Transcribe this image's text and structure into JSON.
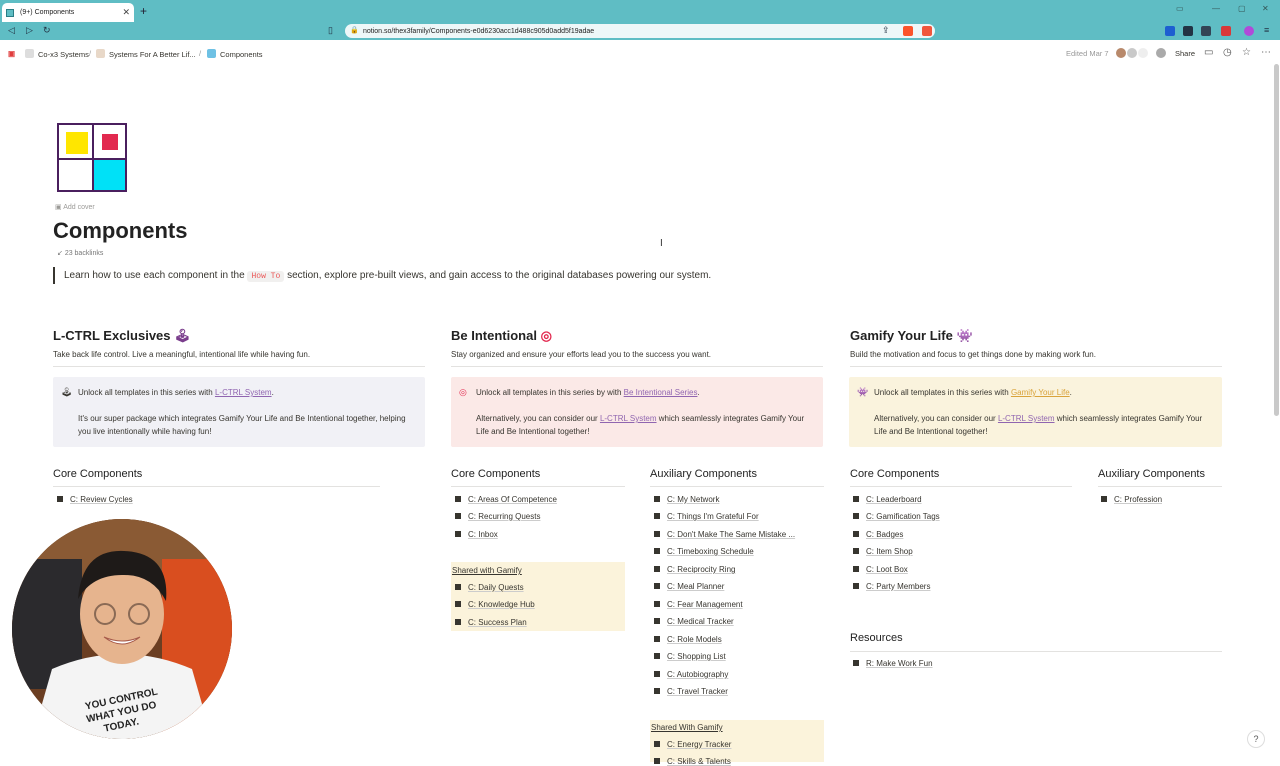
{
  "browser": {
    "tab_title": "(9+) Components",
    "url": "notion.so/thex3family/Components-e0d6230acc1d488c905d0add5f19adae"
  },
  "breadcrumbs": [
    "Co-x3 Systems",
    "Systems For A Better Lif...",
    "Components"
  ],
  "topbar": {
    "edited": "Edited Mar 7",
    "share": "Share"
  },
  "page": {
    "add_cover": "Add cover",
    "title": "Components",
    "backlinks": "23 backlinks",
    "intro_before": "Learn how to use each component in the",
    "intro_code": "How To",
    "intro_after": "section, explore pre-built views, and gain access to the original databases powering our system."
  },
  "columns": {
    "lctrl": {
      "title": "L-CTRL Exclusives",
      "subtitle": "Take back life control. Live a meaningful, intentional life while having fun.",
      "callout_pre": "Unlock all templates in this series with",
      "callout_link": "L-CTRL System",
      "callout_dot": ".",
      "callout_body": "It's our super package which integrates Gamify Your Life and Be Intentional together, helping you live intentionally while having fun!",
      "core_heading": "Core Components",
      "core_items": [
        "C: Review Cycles"
      ]
    },
    "intentional": {
      "title": "Be Intentional",
      "subtitle": "Stay organized and ensure your efforts lead you to the success you want.",
      "callout_pre": "Unlock all templates in this series by with",
      "callout_link": "Be Intentional Series",
      "callout_dot": ".",
      "callout_body_pre": "Alternatively, you can consider our",
      "callout_body_link": "L-CTRL System",
      "callout_body_post": "which seamlessly integrates Gamify Your Life and Be Intentional together!",
      "core_heading": "Core Components",
      "core_items": [
        "C: Areas Of Competence",
        "C: Recurring Quests",
        "C: Inbox"
      ],
      "shared_heading": "Shared with Gamify",
      "shared_items": [
        "C: Daily Quests",
        "C: Knowledge Hub",
        "C: Success Plan"
      ],
      "aux_heading": "Auxiliary Components",
      "aux_items": [
        "C: My Network",
        "C: Things I'm Grateful For",
        "C: Don't Make The Same Mistake ...",
        "C: Timeboxing Schedule",
        "C: Reciprocity Ring",
        "C: Meal Planner",
        "C: Fear Management",
        "C: Medical Tracker",
        "C: Role Models",
        "C: Shopping List",
        "C: Autobiography",
        "C: Travel Tracker"
      ],
      "aux_shared_heading": "Shared With Gamify",
      "aux_shared_items": [
        "C: Energy Tracker",
        "C: Skills & Talents"
      ]
    },
    "gamify": {
      "title": "Gamify Your Life",
      "subtitle": "Build the motivation and focus to get things done by making work fun.",
      "callout_pre": "Unlock all templates in this series with",
      "callout_link": "Gamify Your Life",
      "callout_dot": ".",
      "callout_body_pre": "Alternatively, you can consider our",
      "callout_body_link": "L-CTRL System",
      "callout_body_post": "which seamlessly integrates Gamify Your Life and Be Intentional together!",
      "core_heading": "Core Components",
      "core_items": [
        "C: Leaderboard",
        "C: Gamification Tags",
        "C: Badges",
        "C: Item Shop",
        "C: Loot Box",
        "C: Party Members"
      ],
      "aux_heading": "Auxiliary Components",
      "aux_items": [
        "C: Profession"
      ],
      "resources_heading": "Resources",
      "resources_items": [
        "R: Make Work Fun"
      ]
    }
  },
  "help": "?",
  "colors": {
    "chrome": "#5fbdc4",
    "callout_lctrl": "#f1f1f6",
    "callout_intentional": "#fbe9e7",
    "callout_gamify": "#faf3dd",
    "highlight": "#fbf3db"
  }
}
